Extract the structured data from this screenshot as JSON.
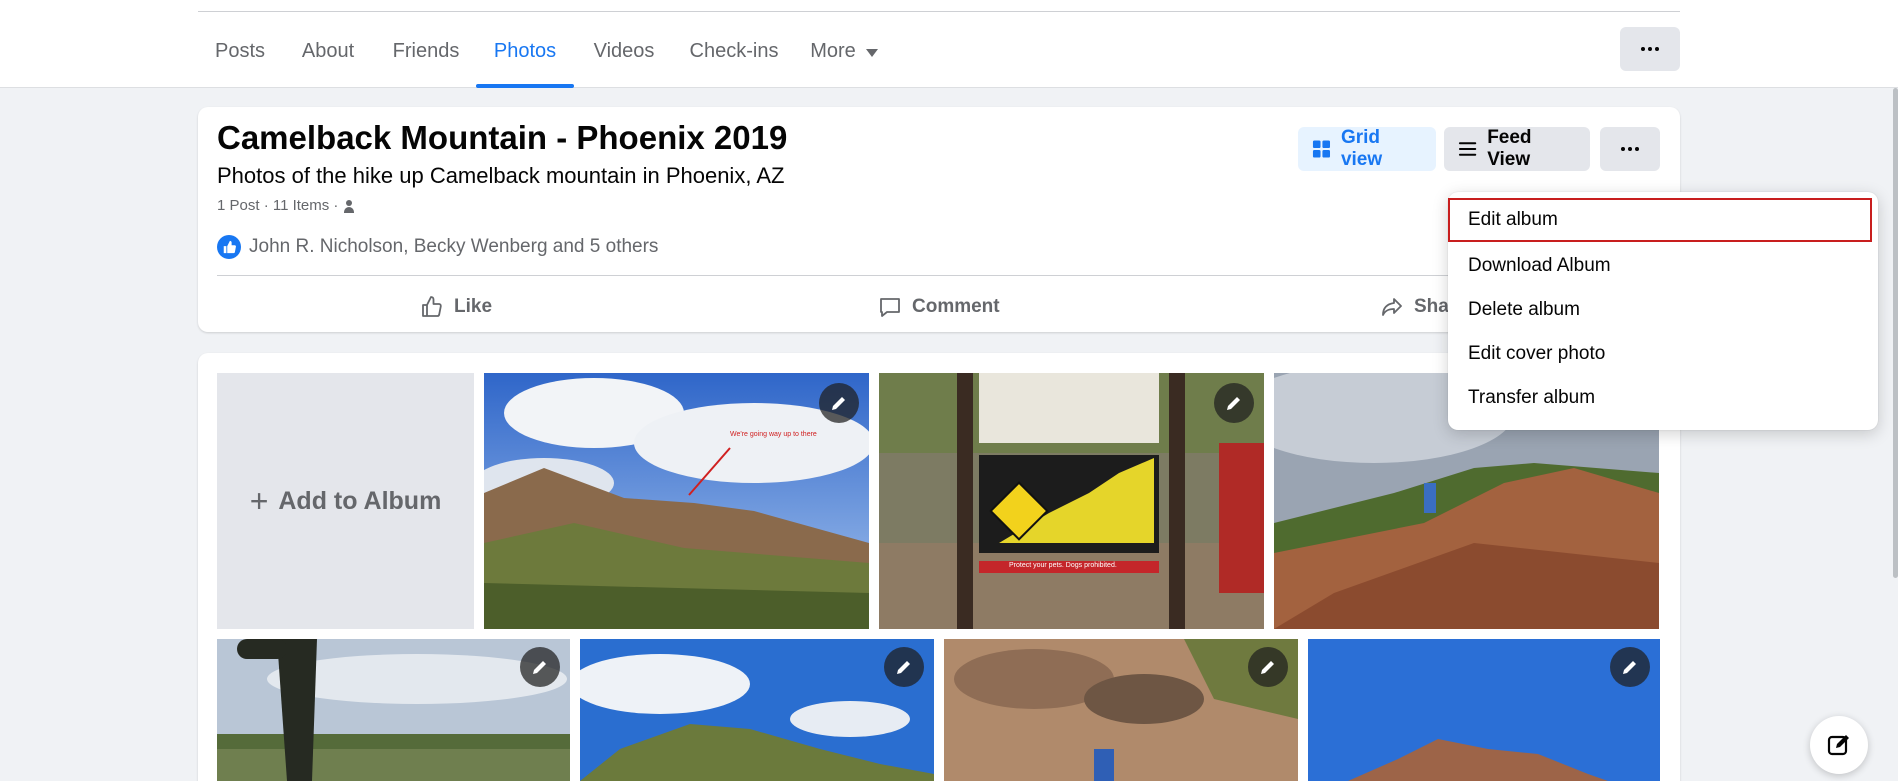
{
  "nav": {
    "tabs": [
      {
        "label": "Posts"
      },
      {
        "label": "About"
      },
      {
        "label": "Friends"
      },
      {
        "label": "Photos",
        "active": true
      },
      {
        "label": "Videos"
      },
      {
        "label": "Check-ins"
      },
      {
        "label": "More"
      }
    ],
    "more_icon": "ellipsis-icon"
  },
  "album": {
    "title": "Camelback Mountain - Phoenix 2019",
    "description": "Photos of the hike up Camelback mountain in Phoenix, AZ",
    "meta": "1 Post · 11 Items ·",
    "likes_text": "John R. Nicholson, Becky Wenberg and 5 others",
    "views": {
      "grid": "Grid view",
      "feed": "Feed View"
    },
    "actions": {
      "like": "Like",
      "comment": "Comment",
      "share": "Share"
    }
  },
  "grid": {
    "add_label": "Add to Album",
    "photos": [
      {
        "alt": "desert hillside under cloudy sky",
        "caption": "We're going way up to there"
      },
      {
        "alt": "trail sign with extreme difficulty warning",
        "caption": "Protect your pets. Dogs prohibited."
      },
      {
        "alt": "hiker on red rocks"
      },
      {
        "alt": "saguaro cactus overlooking city"
      },
      {
        "alt": "green mountain under blue sky"
      },
      {
        "alt": "rocky trail with hiker"
      },
      {
        "alt": "rock formation under blue sky"
      }
    ]
  },
  "menu": {
    "items": [
      {
        "label": "Edit album"
      },
      {
        "label": "Download Album"
      },
      {
        "label": "Delete album"
      },
      {
        "label": "Edit cover photo"
      },
      {
        "label": "Transfer album"
      }
    ]
  },
  "colors": {
    "accent": "#1877f2",
    "highlight_border": "#c81e1e",
    "background": "#f0f2f5"
  }
}
